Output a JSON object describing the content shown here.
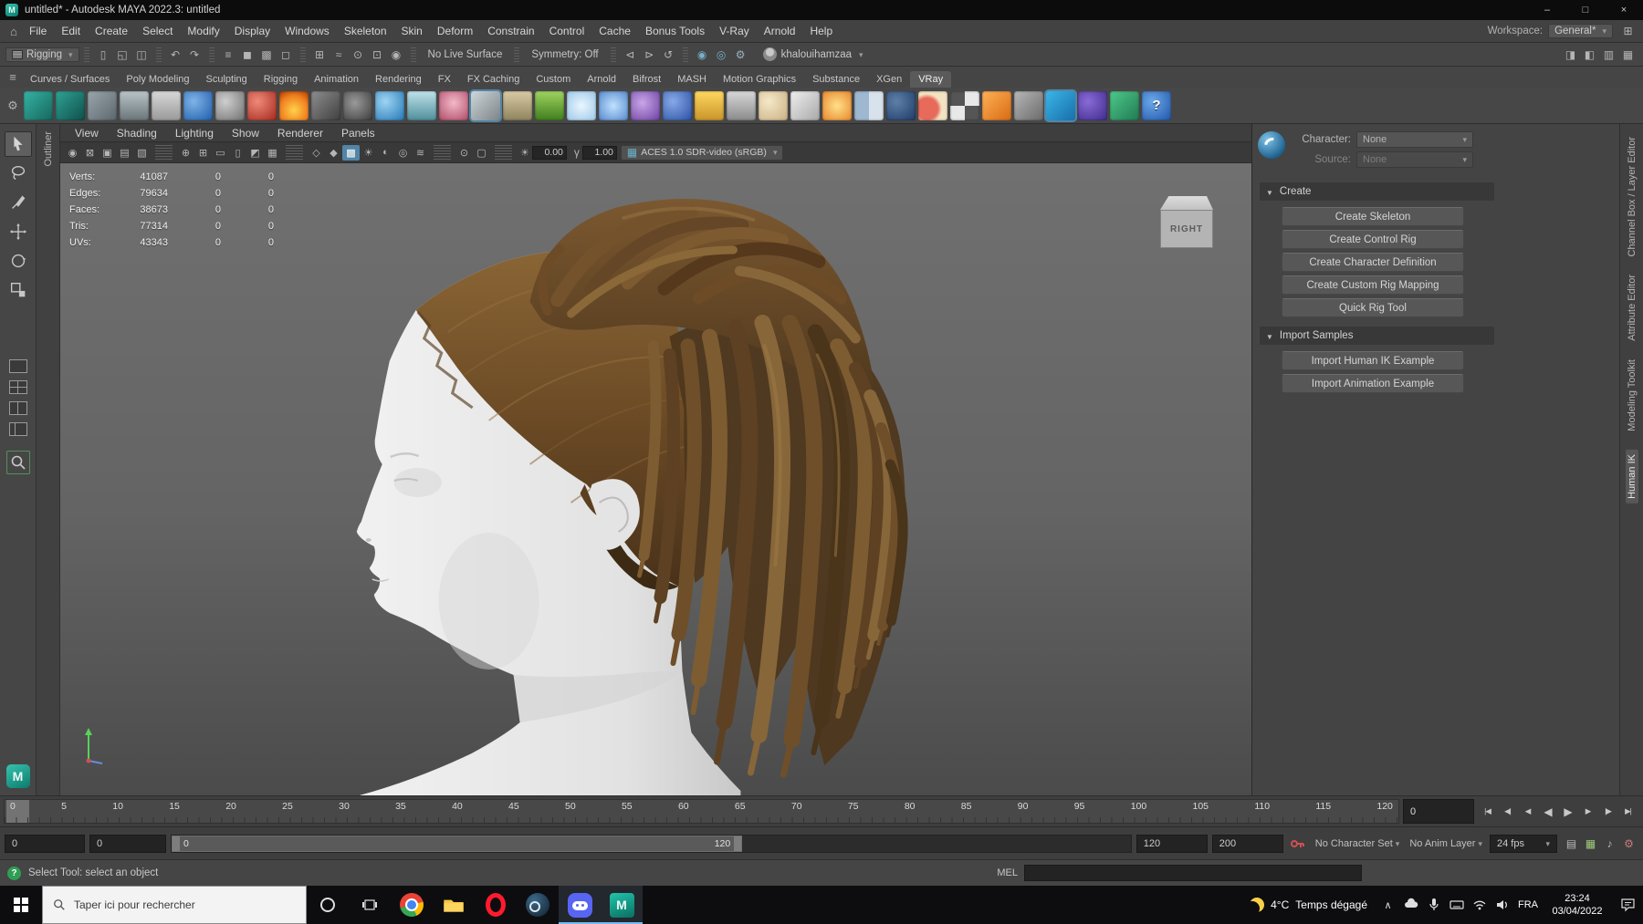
{
  "colors": {
    "accent_blue": "#5285a6",
    "panel_bg": "#444444",
    "text_main": "#cccccc",
    "viewport_top": "#707070",
    "viewport_bottom": "#4b4b4b",
    "skin_light": "#ececec",
    "hair_dark": "#49321a",
    "hair_mid": "#6b4a25",
    "hair_light": "#8a6535",
    "taskbar_bg": "#0d0d10",
    "discord_blurple": "#5865f2",
    "maya_teal": "#0f9b8e"
  },
  "title_bar": {
    "app_title": "untitled* - Autodesk MAYA 2022.3: untitled",
    "minimize": "–",
    "maximize": "□",
    "close": "×"
  },
  "menu_bar": {
    "menus": [
      {
        "label": "File"
      },
      {
        "label": "Edit"
      },
      {
        "label": "Create"
      },
      {
        "label": "Select"
      },
      {
        "label": "Modify"
      },
      {
        "label": "Display"
      },
      {
        "label": "Windows"
      },
      {
        "label": "Skeleton"
      },
      {
        "label": "Skin"
      },
      {
        "label": "Deform"
      },
      {
        "label": "Constrain"
      },
      {
        "label": "Control"
      },
      {
        "label": "Cache"
      },
      {
        "label": "Bonus Tools"
      },
      {
        "label": "V-Ray"
      },
      {
        "label": "Arnold"
      },
      {
        "label": "Help"
      }
    ],
    "workspace_label": "Workspace:",
    "workspace_value": "General*"
  },
  "status_line": {
    "menu_set": "Rigging",
    "live_surface": "No Live Surface",
    "symmetry": "Symmetry: Off",
    "user": "khalouihamzaa",
    "icons_a": [
      {
        "name": "divider",
        "divider": true
      },
      {
        "name": "new-scene-icon",
        "glyph": "▯"
      },
      {
        "name": "open-scene-icon",
        "glyph": "◱"
      },
      {
        "name": "save-scene-icon",
        "glyph": "◫"
      },
      {
        "name": "divider",
        "divider": true
      },
      {
        "name": "undo-icon",
        "glyph": "↶"
      },
      {
        "name": "redo-icon",
        "glyph": "↷"
      },
      {
        "name": "divider",
        "divider": true
      },
      {
        "name": "select-hierarchy-icon",
        "glyph": "≡"
      },
      {
        "name": "select-object-icon",
        "glyph": "◼"
      },
      {
        "name": "select-component-icon",
        "glyph": "▩"
      },
      {
        "name": "highlight-selection-icon",
        "glyph": "◻"
      },
      {
        "name": "divider",
        "divider": true
      },
      {
        "name": "snap-grid-icon",
        "glyph": "⊞"
      },
      {
        "name": "snap-curve-icon",
        "glyph": "≈"
      },
      {
        "name": "snap-point-icon",
        "glyph": "⊙"
      },
      {
        "name": "snap-plane-icon",
        "glyph": "⊡"
      },
      {
        "name": "make-live-icon",
        "glyph": "◉"
      },
      {
        "name": "divider",
        "divider": true
      }
    ],
    "icons_b": [
      {
        "name": "divider",
        "divider": true
      },
      {
        "name": "input-connections-icon",
        "glyph": "⊲"
      },
      {
        "name": "output-connections-icon",
        "glyph": "⊳"
      },
      {
        "name": "construction-history-icon",
        "glyph": "↺"
      },
      {
        "name": "divider",
        "divider": true
      },
      {
        "name": "render-icon",
        "glyph": "◉",
        "color": "#77aec6"
      },
      {
        "name": "ipr-render-icon",
        "glyph": "◎",
        "color": "#77aec6"
      },
      {
        "name": "render-settings-icon",
        "glyph": "⚙",
        "color": "#9ab0bc"
      }
    ],
    "icons_right": [
      {
        "name": "sidebar-channel-box-icon",
        "glyph": "◨"
      },
      {
        "name": "sidebar-attribute-editor-icon",
        "glyph": "◧"
      },
      {
        "name": "sidebar-tool-settings-icon",
        "glyph": "▥"
      },
      {
        "name": "workspace-panels-icon",
        "glyph": "▦"
      }
    ]
  },
  "shelf": {
    "tabs": [
      {
        "label": "Curves / Surfaces",
        "name": "shelf-tab-curves-surfaces"
      },
      {
        "label": "Poly Modeling",
        "name": "shelf-tab-poly-modeling"
      },
      {
        "label": "Sculpting",
        "name": "shelf-tab-sculpting"
      },
      {
        "label": "Rigging",
        "name": "shelf-tab-rigging"
      },
      {
        "label": "Animation",
        "name": "shelf-tab-animation"
      },
      {
        "label": "Rendering",
        "name": "shelf-tab-rendering"
      },
      {
        "label": "FX",
        "name": "shelf-tab-fx"
      },
      {
        "label": "FX Caching",
        "name": "shelf-tab-fx-caching"
      },
      {
        "label": "Custom",
        "name": "shelf-tab-custom"
      },
      {
        "label": "Arnold",
        "name": "shelf-tab-arnold"
      },
      {
        "label": "Bifrost",
        "name": "shelf-tab-bifrost"
      },
      {
        "label": "MASH",
        "name": "shelf-tab-mash"
      },
      {
        "label": "Motion Graphics",
        "name": "shelf-tab-motion-graphics"
      },
      {
        "label": "Substance",
        "name": "shelf-tab-substance"
      },
      {
        "label": "XGen",
        "name": "shelf-tab-xgen"
      },
      {
        "label": "VRay",
        "name": "shelf-tab-vray",
        "active": true
      }
    ],
    "icons": [
      {
        "name": "ep-curve-tool-icon",
        "bg": "linear-gradient(135deg,#35b4a4,#17655c)"
      },
      {
        "name": "bezier-curve-tool-icon",
        "bg": "linear-gradient(135deg,#2fa396,#0f4f49)"
      },
      {
        "name": "nurbs-plane-icon",
        "bg": "linear-gradient(135deg,#9aa7ad,#5b676d)"
      },
      {
        "name": "glass-material-icon",
        "bg": "linear-gradient(180deg,#b9c4c9,#6a757a)"
      },
      {
        "name": "notes-icon",
        "bg": "linear-gradient(180deg,#d8d8d8,#9a9a9a)"
      },
      {
        "name": "earth-texture-icon",
        "bg": "radial-gradient(circle at 35% 35%,#7fb3e8,#1d5ca8)"
      },
      {
        "name": "grey-spheres-icon",
        "bg": "radial-gradient(circle at 35% 35%,#cfcfcf,#6f6f6f)"
      },
      {
        "name": "red-shader-icon",
        "bg": "radial-gradient(circle at 35% 35%,#ef8a7a,#a3271c)"
      },
      {
        "name": "fire-fx-icon",
        "bg": "radial-gradient(circle at 50% 65%,#ffd24a,#f07f1f 60%,#a33b07)"
      },
      {
        "name": "prism-icon",
        "bg": "linear-gradient(135deg,#8e8e8e,#3f3f3f)"
      },
      {
        "name": "ring-sphere-icon",
        "bg": "radial-gradient(circle at 40% 40%,#9a9a9a,#3a3a3a)"
      },
      {
        "name": "water-drop-icon",
        "bg": "radial-gradient(circle at 35% 35%,#9ed4f2,#2277b5)"
      },
      {
        "name": "waterfall-fx-icon",
        "bg": "linear-gradient(180deg,#bfe3ea,#4f8e9b)"
      },
      {
        "name": "flower-icon",
        "bg": "radial-gradient(circle at 50% 40%,#f2b9c9,#b04a68)"
      },
      {
        "name": "lens-icon",
        "bg": "linear-gradient(135deg,#cfd6d9,#7c8488)",
        "highlight": true
      },
      {
        "name": "sand-texture-icon",
        "bg": "linear-gradient(180deg,#d9cba4,#8f835f)"
      },
      {
        "name": "grass-fx-icon",
        "bg": "linear-gradient(180deg,#9fd45f,#3f7d1e)"
      },
      {
        "name": "snowflake-fx-icon",
        "bg": "radial-gradient(circle at 50% 50%,#eaf6ff,#9cc8e8)"
      },
      {
        "name": "sparkle-fx-icon",
        "bg": "radial-gradient(circle at 50% 50%,#bfe1ff,#5588cc)"
      },
      {
        "name": "purple-swirl-icon",
        "bg": "radial-gradient(circle at 40% 40%,#c9a6e8,#6a3fa0)"
      },
      {
        "name": "blue-sphere-icon",
        "bg": "radial-gradient(circle at 35% 35%,#86a9e8,#2b4fa3)"
      },
      {
        "name": "dome-light-icon",
        "bg": "linear-gradient(180deg,#ffd75e,#c9952a)"
      },
      {
        "name": "funnel-icon",
        "bg": "linear-gradient(180deg,#d8d8d8,#8a8a8a)"
      },
      {
        "name": "cream-sphere-icon",
        "bg": "radial-gradient(circle at 35% 35%,#f5e8c8,#c9b083)"
      },
      {
        "name": "cone-light-icon",
        "bg": "linear-gradient(135deg,#efefef,#a8a8a8)"
      },
      {
        "name": "fireworks-fx-icon",
        "bg": "radial-gradient(circle at 50% 50%,#ffe08a,#e8862a)"
      },
      {
        "name": "split-material-icon",
        "bg": "linear-gradient(90deg,#9db8d0 50%,#d8e2ec 50%)"
      },
      {
        "name": "navy-sphere-icon",
        "bg": "radial-gradient(circle at 35% 35%,#5f7fa8,#1d3a66)"
      },
      {
        "name": "duo-sphere-icon",
        "bg": "radial-gradient(circle at 30% 60%,#e86a5a 0 40%,#f2e3c2 55%)"
      },
      {
        "name": "checker-texture-icon",
        "bg": "conic-gradient(#e8e8e8 0 25%,#555 25% 50%,#e8e8e8 50% 75%,#555 75%)"
      },
      {
        "name": "camera-clapper-icon",
        "bg": "linear-gradient(135deg,#ffb258,#d86a12)"
      },
      {
        "name": "rig-tool-icon",
        "bg": "linear-gradient(135deg,#b8b8b8,#6a6a6a)"
      },
      {
        "name": "substance-icon",
        "bg": "linear-gradient(135deg,#39b5e8,#1a6ea8)",
        "highlight": true
      },
      {
        "name": "vray-sphere-icon",
        "bg": "radial-gradient(circle at 35% 35%,#8a6ad8,#3d2a88)"
      },
      {
        "name": "xgen-icon",
        "bg": "linear-gradient(135deg,#4fc98a,#1f7a52)"
      },
      {
        "name": "help-icon",
        "bg": "radial-gradient(circle at 35% 35%,#6aa8e8,#2255aa)",
        "glyph": "?"
      }
    ]
  },
  "left_strip": {
    "label": "Outliner"
  },
  "viewport": {
    "menus": [
      "View",
      "Shading",
      "Lighting",
      "Show",
      "Renderer",
      "Panels"
    ],
    "icons_a": [
      {
        "name": "select-camera-icon",
        "glyph": "◉"
      },
      {
        "name": "lock-camera-icon",
        "glyph": "⊠"
      },
      {
        "name": "camera-attributes-icon",
        "glyph": "▣"
      },
      {
        "name": "bookmarks-icon",
        "glyph": "▤"
      },
      {
        "name": "image-plane-icon",
        "glyph": "▧"
      },
      {
        "name": "divider",
        "divider": true
      },
      {
        "name": "two-d-pan-zoom-icon",
        "glyph": "⊕"
      },
      {
        "name": "grid-toggle-icon",
        "glyph": "⊞"
      },
      {
        "name": "film-gate-icon",
        "glyph": "▭"
      },
      {
        "name": "resolution-gate-icon",
        "glyph": "▯"
      },
      {
        "name": "gate-mask-icon",
        "glyph": "◩"
      },
      {
        "name": "field-chart-icon",
        "glyph": "▦"
      },
      {
        "name": "divider",
        "divider": true
      }
    ],
    "icons_b": [
      {
        "name": "wireframe-icon",
        "glyph": "◇"
      },
      {
        "name": "shaded-icon",
        "glyph": "◆"
      },
      {
        "name": "textured-icon",
        "glyph": "▩",
        "highlight": true
      },
      {
        "name": "lights-icon",
        "glyph": "☀"
      },
      {
        "name": "shadows-icon",
        "glyph": "◐"
      },
      {
        "name": "ao-icon",
        "glyph": "◎"
      },
      {
        "name": "motion-blur-icon",
        "glyph": "≋"
      },
      {
        "name": "divider",
        "divider": true
      },
      {
        "name": "isolate-select-icon",
        "glyph": "⊙"
      },
      {
        "name": "xray-icon",
        "glyph": "▢"
      },
      {
        "name": "divider",
        "divider": true
      }
    ],
    "exposure": "0.00",
    "gamma": "1.00",
    "colorspace": "ACES 1.0 SDR-video (sRGB)",
    "view_cube_label": "RIGHT",
    "hud_rows": [
      {
        "label": "Verts:",
        "value": "41087",
        "a": "0",
        "b": "0"
      },
      {
        "label": "Edges:",
        "value": "79634",
        "a": "0",
        "b": "0"
      },
      {
        "label": "Faces:",
        "value": "38673",
        "a": "0",
        "b": "0"
      },
      {
        "label": "Tris:",
        "value": "77314",
        "a": "0",
        "b": "0"
      },
      {
        "label": "UVs:",
        "value": "43343",
        "a": "0",
        "b": "0"
      }
    ]
  },
  "right_panel": {
    "character_label": "Character:",
    "character_value": "None",
    "source_label": "Source:",
    "source_value": "None",
    "create_section": "Create",
    "create_buttons": [
      {
        "label": "Create Skeleton",
        "name": "create-skeleton-button"
      },
      {
        "label": "Create Control Rig",
        "name": "create-control-rig-button"
      },
      {
        "label": "Create Character Definition",
        "name": "create-character-definition-button"
      },
      {
        "label": "Create Custom Rig Mapping",
        "name": "create-custom-rig-mapping-button"
      },
      {
        "label": "Quick Rig Tool",
        "name": "quick-rig-tool-button"
      }
    ],
    "import_section": "Import Samples",
    "import_buttons": [
      {
        "label": "Import Human IK Example",
        "name": "import-human-ik-example-button"
      },
      {
        "label": "Import Animation Example",
        "name": "import-animation-example-button"
      }
    ]
  },
  "right_tabs": [
    {
      "label": "Channel Box / Layer Editor",
      "name": "tab-channel-box-layer-editor"
    },
    {
      "label": "Attribute Editor",
      "name": "tab-attribute-editor"
    },
    {
      "label": "Modeling Toolkit",
      "name": "tab-modeling-toolkit"
    },
    {
      "label": "Human IK",
      "name": "tab-human-ik",
      "active": true
    }
  ],
  "timeline": {
    "ticks": [
      "0",
      "5",
      "10",
      "15",
      "20",
      "25",
      "30",
      "35",
      "40",
      "45",
      "50",
      "55",
      "60",
      "65",
      "70",
      "75",
      "80",
      "85",
      "90",
      "95",
      "100",
      "105",
      "110",
      "115",
      "120"
    ],
    "current_frame": "0",
    "playback": [
      {
        "name": "go-to-start-button",
        "glyph": "|◀"
      },
      {
        "name": "step-back-key-button",
        "glyph": "◀|"
      },
      {
        "name": "step-back-frame-button",
        "glyph": "◀"
      },
      {
        "name": "play-backward-button",
        "glyph": "◀",
        "big": true
      },
      {
        "name": "play-forward-button",
        "glyph": "▶",
        "big": true
      },
      {
        "name": "step-forward-frame-button",
        "glyph": "▶"
      },
      {
        "name": "step-forward-key-button",
        "glyph": "|▶"
      },
      {
        "name": "go-to-end-button",
        "glyph": "▶|"
      }
    ]
  },
  "range_slider": {
    "anim_start": "0",
    "playback_start": "0",
    "range_start_label": "0",
    "range_end_label": "120",
    "playback_end": "120",
    "anim_end": "200",
    "character_set": "No Character Set",
    "anim_layer": "No Anim Layer",
    "fps": "24 fps",
    "tray_icons": [
      {
        "name": "time-editor-icon",
        "glyph": "▤",
        "color": "#b8b8b8"
      },
      {
        "name": "playblast-icon",
        "glyph": "▦",
        "color": "#9cc97a"
      },
      {
        "name": "sound-icon",
        "glyph": "♪",
        "color": "#b8b8b8"
      },
      {
        "name": "preferences-icon",
        "glyph": "⚙",
        "color": "#c87b7b"
      }
    ]
  },
  "help_line": {
    "message": "Select Tool: select an object",
    "mel_label": "MEL"
  },
  "taskbar": {
    "search_placeholder": "Taper ici pour rechercher",
    "weather_temp": "4°C",
    "weather_text": "Temps dégagé",
    "language": "FRA",
    "time": "23:24",
    "date": "03/04/2022"
  }
}
